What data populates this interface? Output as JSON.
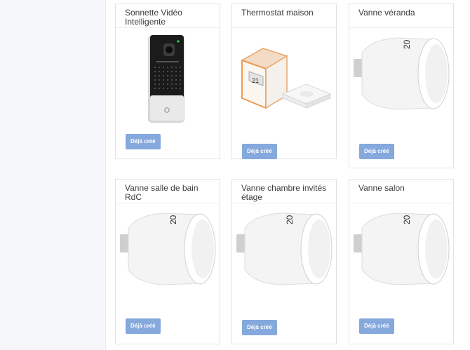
{
  "devices": [
    {
      "title": "Sonnette Vidéo Intelligente",
      "badge": "Déjà créé",
      "icon": "doorbell-image"
    },
    {
      "title": "Thermostat maison",
      "badge": "Déjà créé",
      "icon": "thermostat-image",
      "display": "21"
    },
    {
      "title": "Vanne véranda",
      "badge": "Déjà créé",
      "icon": "valve-image",
      "display": "20"
    },
    {
      "title": "Vanne salle de bain RdC",
      "badge": "Déjà créé",
      "icon": "valve-image",
      "display": "20"
    },
    {
      "title": "Vanne chambre invités étage",
      "badge": "Déjà créé",
      "icon": "valve-image",
      "display": "20"
    },
    {
      "title": "Vanne salon",
      "badge": "Déjà créé",
      "icon": "valve-image",
      "display": "20"
    }
  ]
}
